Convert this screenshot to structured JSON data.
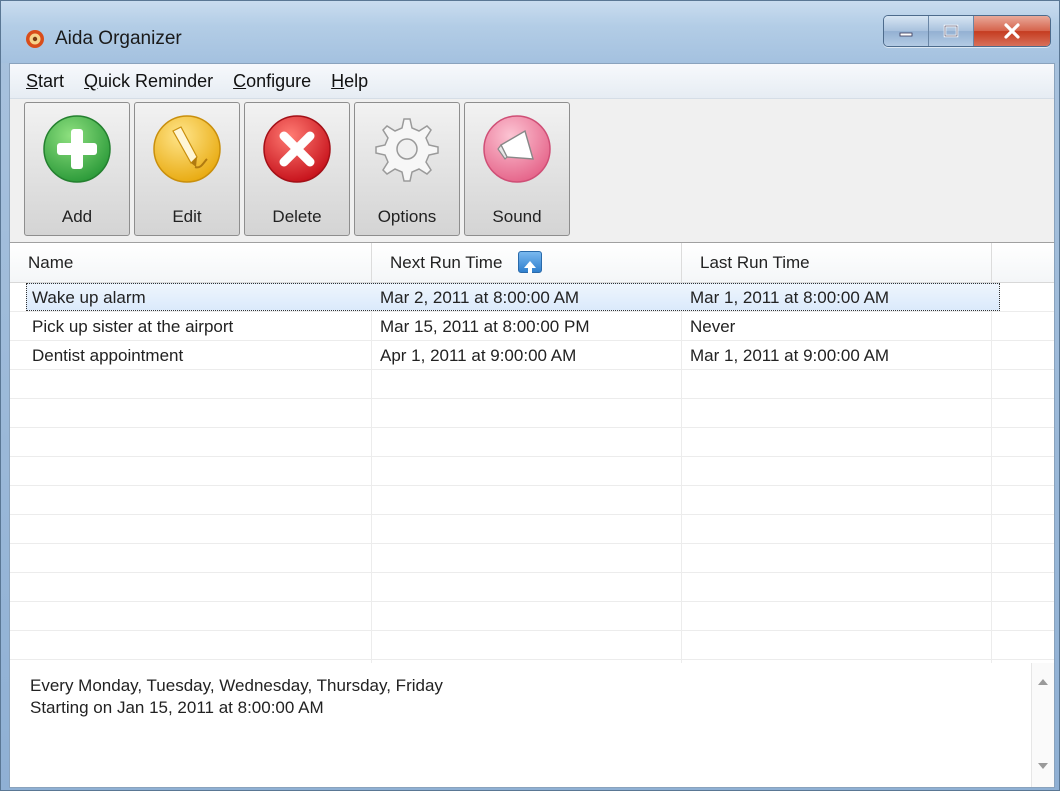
{
  "window": {
    "title": "Aida Organizer",
    "buttons": [
      "minimize",
      "maximize",
      "close"
    ]
  },
  "menu": [
    {
      "label": "Start",
      "accel": "S",
      "rest": "tart"
    },
    {
      "label": "Quick Reminder",
      "accel": "Q",
      "rest": "uick Reminder"
    },
    {
      "label": "Configure",
      "accel": "C",
      "rest": "onfigure"
    },
    {
      "label": "Help",
      "accel": "H",
      "rest": "elp"
    }
  ],
  "toolbar": {
    "add_label": "Add",
    "edit_label": "Edit",
    "delete_label": "Delete",
    "options_label": "Options",
    "sound_label": "Sound"
  },
  "list": {
    "columns": [
      "Name",
      "Next Run Time",
      "Last Run Time"
    ],
    "sorted_column": "Next Run Time",
    "rows": [
      {
        "name": "Wake up alarm",
        "next": "Mar 2, 2011 at 8:00:00 AM",
        "last": "Mar 1, 2011 at 8:00:00 AM"
      },
      {
        "name": "Pick up sister at the airport",
        "next": "Mar 15, 2011 at 8:00:00 PM",
        "last": "Never"
      },
      {
        "name": "Dentist appointment",
        "next": "Apr 1, 2011 at 9:00:00 AM",
        "last": "Mar 1, 2011 at 9:00:00 AM"
      }
    ],
    "selected_row": 0
  },
  "details": {
    "line1": "Every Monday, Tuesday, Wednesday, Thursday, Friday",
    "line2": "Starting on Jan 15, 2011 at 8:00:00 AM"
  },
  "colors": {
    "add": "#3cb54a",
    "edit": "#f2c12e",
    "delete": "#d9262a",
    "sound": "#f08aa6",
    "selection": "#dbeafb"
  }
}
